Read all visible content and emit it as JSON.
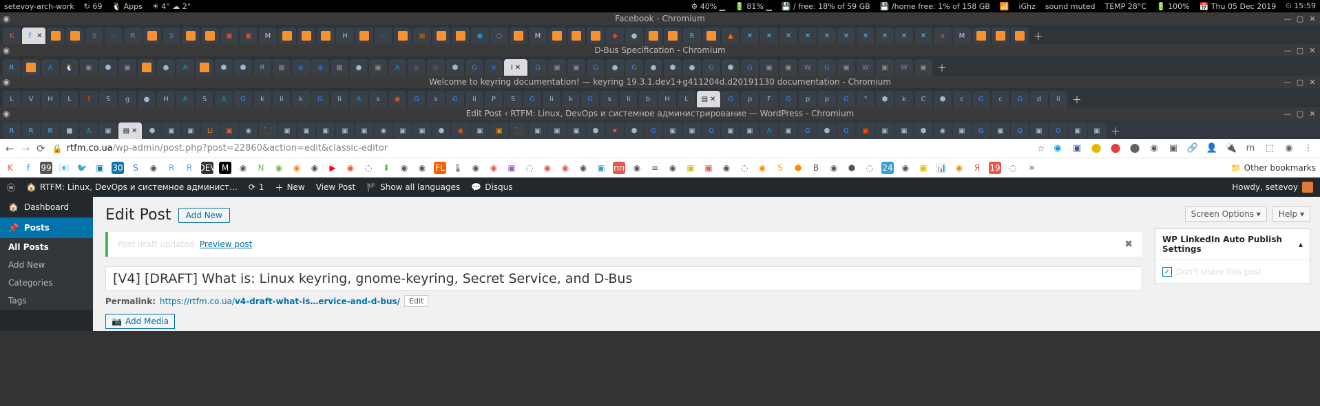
{
  "sysbar": {
    "hostname": "setevoy-arch-work",
    "updates": "↻ 69",
    "apps": "🐧 Apps",
    "weather": "☀ 4°  ☁ 2°",
    "cpu": "⚙ 40% ▁",
    "bat": "🔋 81% ▁",
    "disk1": "💾 / free: 18% of 59 GB",
    "disk2": "💾 /home free: 1% of 158 GB",
    "wifi": "📶",
    "freq": "iGhz",
    "sound": "sound muted",
    "temp": "TEMP 28°C",
    "battery2": "🔋 100%",
    "date": "📅 Thu 05 Dec 2019",
    "time": "⏲ 15:59"
  },
  "windows": [
    {
      "title": "Facebook - Chromium"
    },
    {
      "title": "D-Bus Specification - Chromium"
    },
    {
      "title": "Welcome to keyring documentation! — keyring 19.3.1.dev1+g411204d.d20191130 documentation - Chromium"
    },
    {
      "title": "Edit Post ‹ RTFM: Linux, DevOps и системное администрирование — WordPress - Chromium"
    }
  ],
  "nav": {
    "url_host": "rtfm.co.ua",
    "url_path": "/wp-admin/post.php?post=22860&action=edit&classic-editor"
  },
  "bookmarks": {
    "other": "Other bookmarks"
  },
  "wp_adminbar": {
    "site": "RTFM: Linux, DevOps и системное админист…",
    "updates": "1",
    "new": "New",
    "view": "View Post",
    "showall": "Show all languages",
    "disqus": "Disqus",
    "howdy": "Howdy, setevoy"
  },
  "wp_sidebar": {
    "dashboard": "Dashboard",
    "posts": "Posts",
    "sub": {
      "all": "All Posts",
      "add": "Add New",
      "cat": "Categories",
      "tags": "Tags"
    }
  },
  "wp_main": {
    "heading": "Edit Post",
    "addnew": "Add New",
    "notice_text": "Post draft updated. ",
    "preview": "Preview post",
    "title_value": "[V4] [DRAFT] What is: Linux keyring, gnome-keyring, Secret Service, and D-Bus",
    "permalink_label": "Permalink:",
    "permalink_prefix": "https://rtfm.co.ua/",
    "permalink_slug": "v4-draft-what-is…ervice-and-d-bus/",
    "edit": "Edit",
    "addmedia": "Add Media"
  },
  "wp_right": {
    "screen_options": "Screen Options ▾",
    "help": "Help ▾",
    "metabox_title": "WP LinkedIn Auto Publish Settings",
    "dont_share": "Don't share this post"
  }
}
